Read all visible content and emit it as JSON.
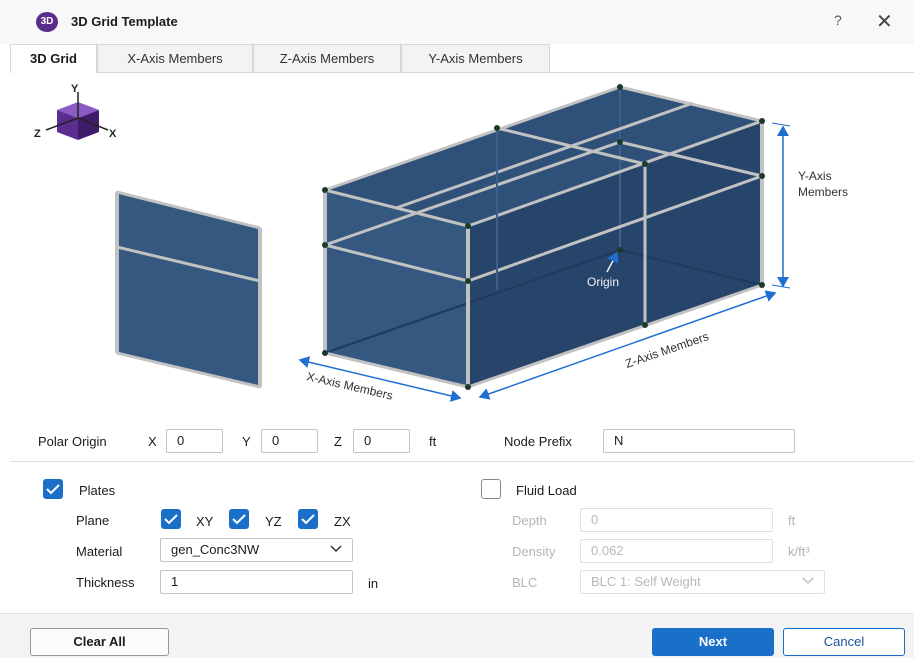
{
  "window": {
    "icon_text": "3D",
    "title": "3D Grid Template",
    "help": "?",
    "close": "✕"
  },
  "tabs": [
    {
      "label": "3D Grid",
      "active": true
    },
    {
      "label": "X-Axis Members",
      "active": false
    },
    {
      "label": "Z-Axis Members",
      "active": false
    },
    {
      "label": "Y-Axis Members",
      "active": false
    }
  ],
  "diagram": {
    "axis_y": "Y",
    "axis_z": "Z",
    "axis_x": "X",
    "y_members_line1": "Y-Axis",
    "y_members_line2": "Members",
    "origin": "Origin",
    "z_members": "Z-Axis Members",
    "x_members": "X-Axis Members"
  },
  "polar_origin": {
    "label": "Polar Origin",
    "x_label": "X",
    "x_value": "0",
    "y_label": "Y",
    "y_value": "0",
    "z_label": "Z",
    "z_value": "0",
    "unit": "ft"
  },
  "node_prefix": {
    "label": "Node Prefix",
    "value": "N"
  },
  "plates": {
    "label": "Plates",
    "checked": true,
    "plane_label": "Plane",
    "planes": [
      {
        "label": "XY",
        "checked": true
      },
      {
        "label": "YZ",
        "checked": true
      },
      {
        "label": "ZX",
        "checked": true
      }
    ],
    "material_label": "Material",
    "material_value": "gen_Conc3NW",
    "thickness_label": "Thickness",
    "thickness_value": "1",
    "thickness_unit": "in"
  },
  "fluid_load": {
    "label": "Fluid Load",
    "checked": false,
    "depth_label": "Depth",
    "depth_value": "0",
    "depth_unit": "ft",
    "density_label": "Density",
    "density_value": "0.062",
    "density_unit": "k/ft³",
    "blc_label": "BLC",
    "blc_value": "BLC 1: Self Weight"
  },
  "footer": {
    "clear_all": "Clear All",
    "next": "Next",
    "cancel": "Cancel"
  },
  "colors": {
    "accent": "#1a6fc9",
    "plate": "#2b4a73",
    "member": "#b8b8b8",
    "cube": "#5b2d91",
    "arrow": "#1f6fd1"
  }
}
